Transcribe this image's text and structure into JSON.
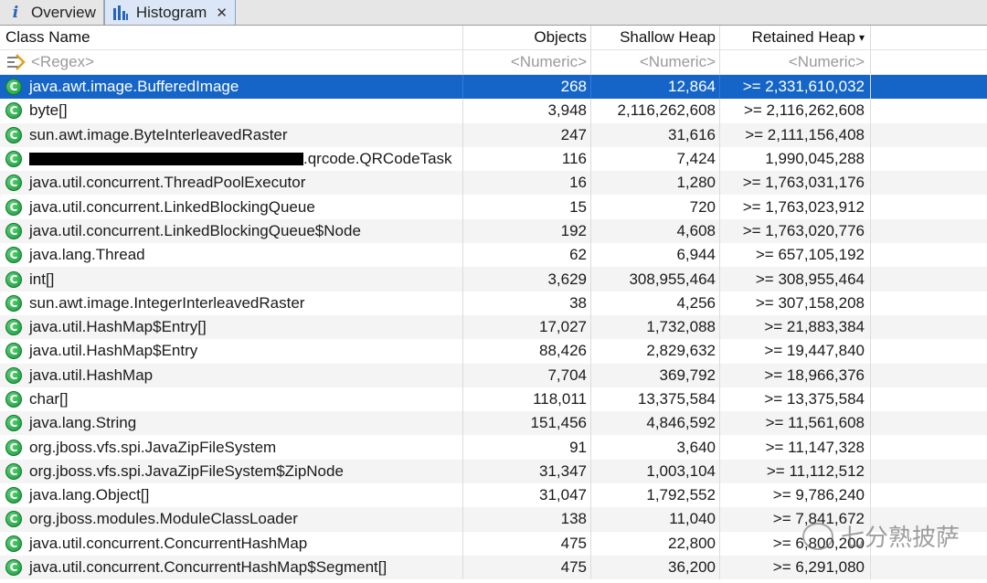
{
  "tabs": [
    {
      "label": "Overview",
      "icon": "info-icon",
      "active": false
    },
    {
      "label": "Histogram",
      "icon": "histogram-icon",
      "active": true,
      "closable": true
    }
  ],
  "columns": {
    "class_name": "Class Name",
    "objects": "Objects",
    "shallow_heap": "Shallow Heap",
    "retained_heap": "Retained Heap"
  },
  "filter": {
    "class_name": "<Regex>",
    "objects": "<Numeric>",
    "shallow_heap": "<Numeric>",
    "retained_heap": "<Numeric>"
  },
  "rows": [
    {
      "name": "java.awt.image.BufferedImage",
      "objects": "268",
      "shallow": "12,864",
      "retained": ">= 2,331,610,032"
    },
    {
      "name": "byte[]",
      "objects": "3,948",
      "shallow": "2,116,262,608",
      "retained": ">= 2,116,262,608"
    },
    {
      "name": "sun.awt.image.ByteInterleavedRaster",
      "objects": "247",
      "shallow": "31,616",
      "retained": ">= 2,111,156,408"
    },
    {
      "name": ".qrcode.QRCodeTask",
      "objects": "116",
      "shallow": "7,424",
      "retained": "1,990,045,288",
      "redacted_prefix": true
    },
    {
      "name": "java.util.concurrent.ThreadPoolExecutor",
      "objects": "16",
      "shallow": "1,280",
      "retained": ">= 1,763,031,176"
    },
    {
      "name": "java.util.concurrent.LinkedBlockingQueue",
      "objects": "15",
      "shallow": "720",
      "retained": ">= 1,763,023,912"
    },
    {
      "name": "java.util.concurrent.LinkedBlockingQueue$Node",
      "objects": "192",
      "shallow": "4,608",
      "retained": ">= 1,763,020,776"
    },
    {
      "name": "java.lang.Thread",
      "objects": "62",
      "shallow": "6,944",
      "retained": ">= 657,105,192"
    },
    {
      "name": "int[]",
      "objects": "3,629",
      "shallow": "308,955,464",
      "retained": ">= 308,955,464"
    },
    {
      "name": "sun.awt.image.IntegerInterleavedRaster",
      "objects": "38",
      "shallow": "4,256",
      "retained": ">= 307,158,208"
    },
    {
      "name": "java.util.HashMap$Entry[]",
      "objects": "17,027",
      "shallow": "1,732,088",
      "retained": ">= 21,883,384"
    },
    {
      "name": "java.util.HashMap$Entry",
      "objects": "88,426",
      "shallow": "2,829,632",
      "retained": ">= 19,447,840"
    },
    {
      "name": "java.util.HashMap",
      "objects": "7,704",
      "shallow": "369,792",
      "retained": ">= 18,966,376"
    },
    {
      "name": "char[]",
      "objects": "118,011",
      "shallow": "13,375,584",
      "retained": ">= 13,375,584"
    },
    {
      "name": "java.lang.String",
      "objects": "151,456",
      "shallow": "4,846,592",
      "retained": ">= 11,561,608"
    },
    {
      "name": "org.jboss.vfs.spi.JavaZipFileSystem",
      "objects": "91",
      "shallow": "3,640",
      "retained": ">= 11,147,328"
    },
    {
      "name": "org.jboss.vfs.spi.JavaZipFileSystem$ZipNode",
      "objects": "31,347",
      "shallow": "1,003,104",
      "retained": ">= 11,112,512"
    },
    {
      "name": "java.lang.Object[]",
      "objects": "31,047",
      "shallow": "1,792,552",
      "retained": ">= 9,786,240"
    },
    {
      "name": "org.jboss.modules.ModuleClassLoader",
      "objects": "138",
      "shallow": "11,040",
      "retained": ">= 7,841,672"
    },
    {
      "name": "java.util.concurrent.ConcurrentHashMap",
      "objects": "475",
      "shallow": "22,800",
      "retained": ">= 6,800,200"
    },
    {
      "name": "java.util.concurrent.ConcurrentHashMap$Segment[]",
      "objects": "475",
      "shallow": "36,200",
      "retained": ">= 6,291,080"
    }
  ],
  "watermark": "七分熟披萨",
  "colors": {
    "selection": "#1565c8",
    "class_icon": "#1fa84a",
    "tab_active": "#dbe7f7"
  }
}
